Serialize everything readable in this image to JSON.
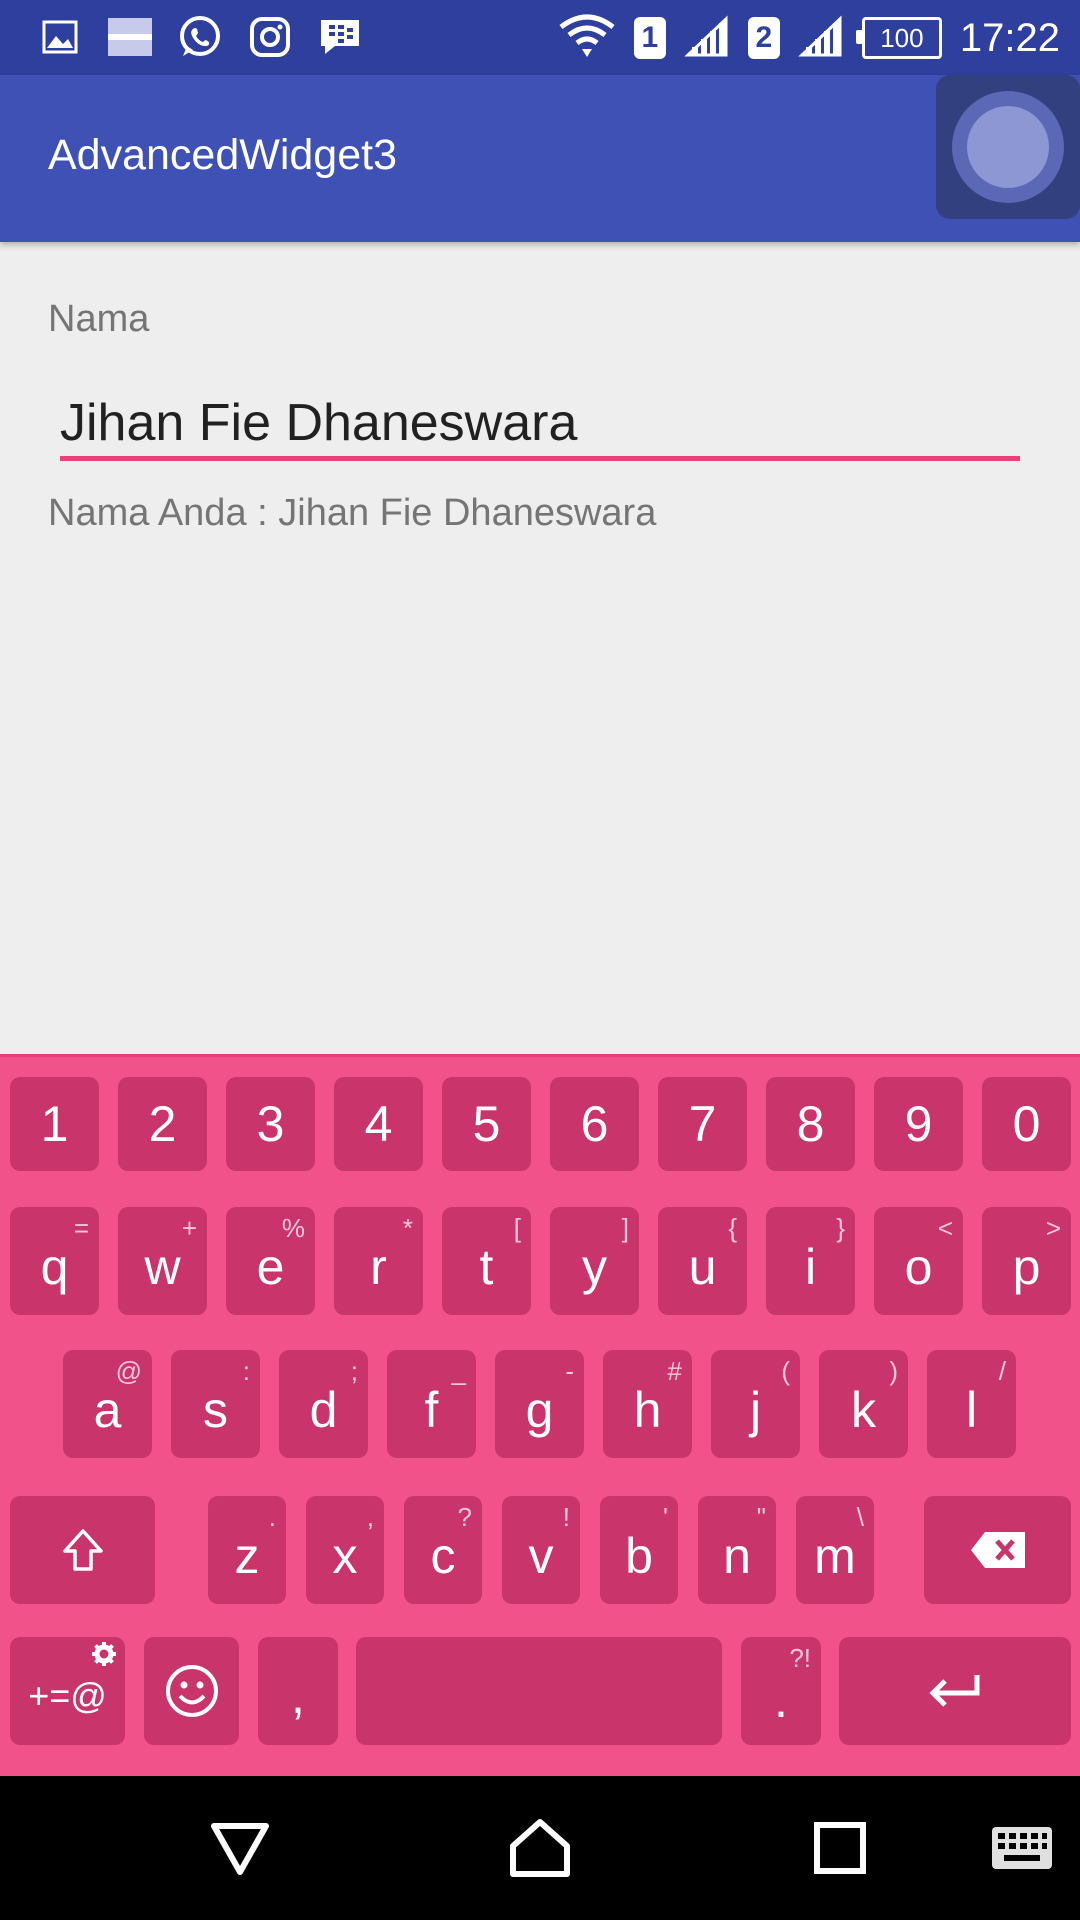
{
  "status_bar": {
    "time": "17:22",
    "battery": "100",
    "sim1": "1",
    "sim2": "2",
    "icons": [
      "gallery-icon",
      "notification-bar-icon",
      "whatsapp-icon",
      "instagram-icon",
      "bbm-icon",
      "wifi-icon",
      "signal-icon"
    ]
  },
  "app_bar": {
    "title": "AdvancedWidget3",
    "color": "#3f51b5"
  },
  "form": {
    "label": "Nama",
    "input_value": "Jihan Fie Dhaneswara",
    "result_text": "Nama Anda : Jihan Fie Dhaneswara",
    "accent": "#ec407a"
  },
  "keyboard": {
    "row_numbers": [
      "1",
      "2",
      "3",
      "4",
      "5",
      "6",
      "7",
      "8",
      "9",
      "0"
    ],
    "row1": [
      {
        "k": "q",
        "h": "="
      },
      {
        "k": "w",
        "h": "+"
      },
      {
        "k": "e",
        "h": "%"
      },
      {
        "k": "r",
        "h": "*"
      },
      {
        "k": "t",
        "h": "["
      },
      {
        "k": "y",
        "h": "]"
      },
      {
        "k": "u",
        "h": "{"
      },
      {
        "k": "i",
        "h": "}"
      },
      {
        "k": "o",
        "h": "<"
      },
      {
        "k": "p",
        "h": ">"
      }
    ],
    "row2": [
      {
        "k": "a",
        "h": "@"
      },
      {
        "k": "s",
        "h": ":"
      },
      {
        "k": "d",
        "h": ";"
      },
      {
        "k": "f",
        "h": "_"
      },
      {
        "k": "g",
        "h": "-"
      },
      {
        "k": "h",
        "h": "#"
      },
      {
        "k": "j",
        "h": "("
      },
      {
        "k": "k",
        "h": ")"
      },
      {
        "k": "l",
        "h": "/"
      }
    ],
    "row3": [
      {
        "k": "z",
        "h": "."
      },
      {
        "k": "x",
        "h": ","
      },
      {
        "k": "c",
        "h": "?"
      },
      {
        "k": "v",
        "h": "!"
      },
      {
        "k": "b",
        "h": "'"
      },
      {
        "k": "n",
        "h": "\""
      },
      {
        "k": "m",
        "h": "\\"
      }
    ],
    "symbols_label": "+=@",
    "comma": ",",
    "period": ".",
    "period_hint": "?!",
    "color": "#f2528a"
  }
}
